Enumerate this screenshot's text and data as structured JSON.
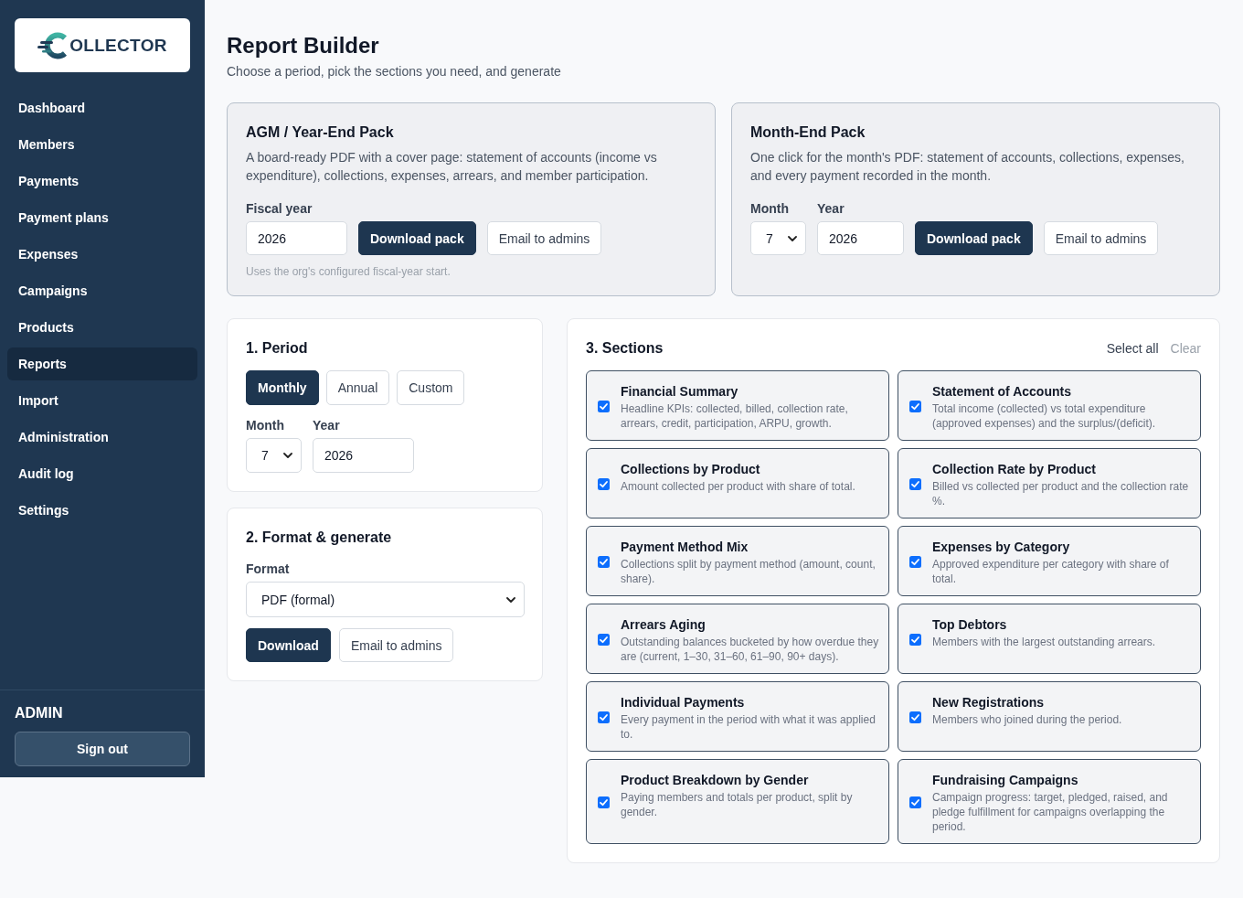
{
  "sidebar": {
    "logo": {
      "wordmark": "OLLECTOR"
    },
    "items": [
      {
        "label": "Dashboard",
        "selected": false
      },
      {
        "label": "Members",
        "selected": false
      },
      {
        "label": "Payments",
        "selected": false
      },
      {
        "label": "Payment plans",
        "selected": false
      },
      {
        "label": "Expenses",
        "selected": false
      },
      {
        "label": "Campaigns",
        "selected": false
      },
      {
        "label": "Products",
        "selected": false
      },
      {
        "label": "Reports",
        "selected": true
      },
      {
        "label": "Import",
        "selected": false
      },
      {
        "label": "Administration",
        "selected": false
      },
      {
        "label": "Audit log",
        "selected": false
      },
      {
        "label": "Settings",
        "selected": false
      }
    ],
    "user": {
      "role": "ADMIN"
    },
    "sign_out": "Sign out"
  },
  "header": {
    "title": "Report Builder",
    "subtitle": "Choose a period, pick the sections you need, and generate"
  },
  "packs": [
    {
      "title": "AGM / Year-End Pack",
      "description": "A board-ready PDF with a cover page: statement of accounts (income vs expenditure), collections, expenses, arrears, and member participation.",
      "fields": [
        {
          "kind": "input",
          "label": "Fiscal year",
          "value": "2026"
        }
      ],
      "primary_button": "Download pack",
      "secondary_button": "Email to admins",
      "hint": "Uses the org's configured fiscal-year start."
    },
    {
      "title": "Month-End Pack",
      "description": "One click for the month's PDF: statement of accounts, collections, expenses, and every payment recorded in the month.",
      "fields": [
        {
          "kind": "select",
          "label": "Month",
          "value": "7"
        },
        {
          "kind": "input",
          "label": "Year",
          "value": "2026"
        }
      ],
      "primary_button": "Download pack",
      "secondary_button": "Email to admins"
    }
  ],
  "period": {
    "title": "1. Period",
    "modes": [
      {
        "label": "Monthly",
        "selected": true
      },
      {
        "label": "Annual",
        "selected": false
      },
      {
        "label": "Custom",
        "selected": false
      }
    ],
    "fields": [
      {
        "kind": "select",
        "label": "Month",
        "value": "7"
      },
      {
        "kind": "input",
        "label": "Year",
        "value": "2026"
      }
    ]
  },
  "format": {
    "title": "2. Format & generate",
    "label": "Format",
    "value": "PDF (formal)",
    "primary_button": "Download",
    "secondary_button": "Email to admins"
  },
  "sections": {
    "title": "3. Sections",
    "select_all": "Select all",
    "clear": "Clear",
    "items": [
      {
        "title": "Financial Summary",
        "description": "Headline KPIs: collected, billed, collection rate, arrears, credit, participation, ARPU, growth.",
        "checked": true
      },
      {
        "title": "Statement of Accounts",
        "description": "Total income (collected) vs total expenditure (approved expenses) and the surplus/(deficit).",
        "checked": true
      },
      {
        "title": "Collections by Product",
        "description": "Amount collected per product with share of total.",
        "checked": true
      },
      {
        "title": "Collection Rate by Product",
        "description": "Billed vs collected per product and the collection rate %.",
        "checked": true
      },
      {
        "title": "Payment Method Mix",
        "description": "Collections split by payment method (amount, count, share).",
        "checked": true
      },
      {
        "title": "Expenses by Category",
        "description": "Approved expenditure per category with share of total.",
        "checked": true
      },
      {
        "title": "Arrears Aging",
        "description": "Outstanding balances bucketed by how overdue they are (current, 1–30, 31–60, 61–90, 90+ days).",
        "checked": true
      },
      {
        "title": "Top Debtors",
        "description": "Members with the largest outstanding arrears.",
        "checked": true
      },
      {
        "title": "Individual Payments",
        "description": "Every payment in the period with what it was applied to.",
        "checked": true
      },
      {
        "title": "New Registrations",
        "description": "Members who joined during the period.",
        "checked": true
      },
      {
        "title": "Product Breakdown by Gender",
        "description": "Paying members and totals per product, split by gender.",
        "checked": true
      },
      {
        "title": "Fundraising Campaigns",
        "description": "Campaign progress: target, pledged, raised, and pledge fulfillment for campaigns overlapping the period.",
        "checked": true
      }
    ]
  }
}
